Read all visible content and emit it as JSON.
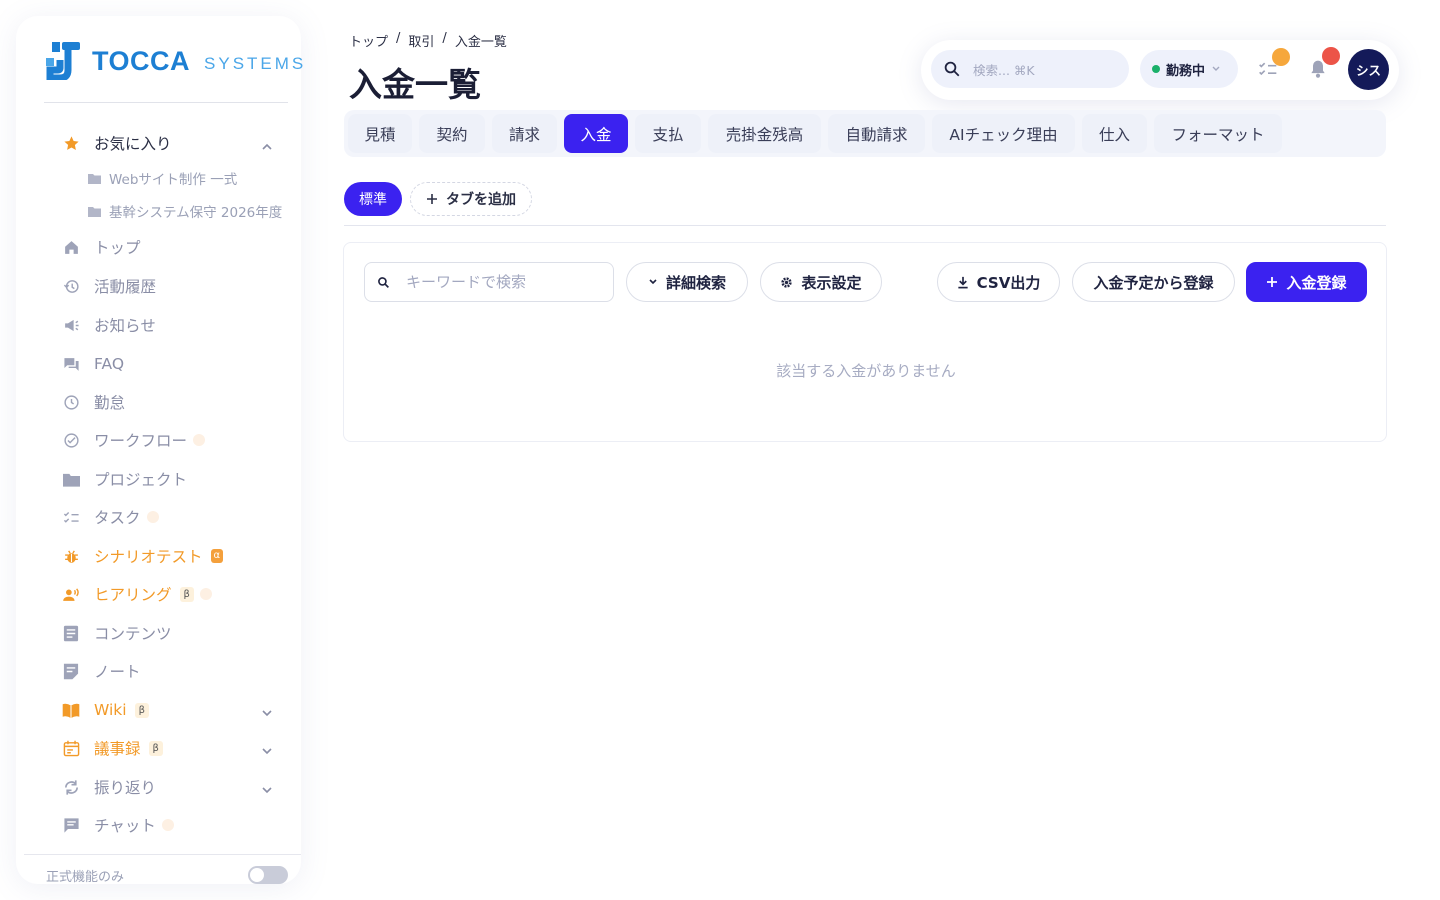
{
  "brand": {
    "name": "TOCCA",
    "suffix": "SYSTEMS"
  },
  "sidebar": {
    "favorites": {
      "label": "お気に入り",
      "items": [
        {
          "label": "Webサイト制作 一式"
        },
        {
          "label": "基幹システム保守 2026年度"
        }
      ]
    },
    "items": [
      {
        "label": "トップ"
      },
      {
        "label": "活動履歴"
      },
      {
        "label": "お知らせ"
      },
      {
        "label": "FAQ"
      },
      {
        "label": "勤怠"
      },
      {
        "label": "ワークフロー"
      },
      {
        "label": "プロジェクト"
      },
      {
        "label": "タスク"
      },
      {
        "label": "シナリオテスト",
        "badge": "α"
      },
      {
        "label": "ヒアリング",
        "badge": "β"
      },
      {
        "label": "コンテンツ"
      },
      {
        "label": "ノート"
      },
      {
        "label": "Wiki",
        "badge": "β"
      },
      {
        "label": "議事録",
        "badge": "β"
      },
      {
        "label": "振り返り"
      },
      {
        "label": "チャット"
      }
    ],
    "official_only_label": "正式機能のみ",
    "official_only_enabled": false
  },
  "breadcrumb": [
    "トップ",
    "取引",
    "入金一覧"
  ],
  "breadcrumb_separator": "/",
  "page_title": "入金一覧",
  "topbar": {
    "search_placeholder": "検索... ⌘K",
    "status_label": "勤務中",
    "avatar_text": "シス"
  },
  "tabs": [
    {
      "label": "見積"
    },
    {
      "label": "契約"
    },
    {
      "label": "請求"
    },
    {
      "label": "入金",
      "active": true
    },
    {
      "label": "支払"
    },
    {
      "label": "売掛金残高"
    },
    {
      "label": "自動請求"
    },
    {
      "label": "AIチェック理由"
    },
    {
      "label": "仕入"
    },
    {
      "label": "フォーマット"
    }
  ],
  "view_tabs": {
    "standard_label": "標準",
    "add_label": "タブを追加"
  },
  "toolbar": {
    "keyword_placeholder": "キーワードで検索",
    "advanced_search_label": "詳細検索",
    "display_settings_label": "表示設定",
    "csv_export_label": "CSV出力",
    "register_from_schedule_label": "入金予定から登録",
    "register_payment_label": "入金登録"
  },
  "empty_message": "該当する入金がありません",
  "colors": {
    "primary": "#3b22f0",
    "accent_orange": "#f29a28",
    "status_green": "#1ab06a",
    "avatar_bg": "#141a59",
    "brand_blue": "#1d7fd3"
  }
}
